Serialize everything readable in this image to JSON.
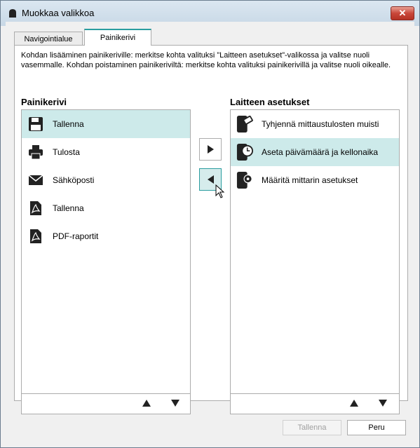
{
  "window": {
    "title": "Muokkaa valikkoa"
  },
  "tabs": [
    {
      "label": "Navigointialue"
    },
    {
      "label": "Painikerivi"
    }
  ],
  "description": "Kohdan lisääminen painikeriville: merkitse kohta valituksi ”Laitteen asetukset”-valikossa ja valitse nuoli vasemmalle. Kohdan poistaminen painikeriviltä: merkitse kohta valituksi painikerivillä ja valitse nuoli oikealle.",
  "left_list": {
    "title": "Painikerivi",
    "items": [
      {
        "label": "Tallenna",
        "icon": "save-icon",
        "selected": true
      },
      {
        "label": "Tulosta",
        "icon": "printer-icon",
        "selected": false
      },
      {
        "label": "Sähköposti",
        "icon": "mail-icon",
        "selected": false
      },
      {
        "label": "Tallenna",
        "icon": "pdf-icon",
        "selected": false
      },
      {
        "label": "PDF-raportit",
        "icon": "pdf-report-icon",
        "selected": false
      }
    ]
  },
  "right_list": {
    "title": "Laitteen asetukset",
    "items": [
      {
        "label": "Tyhjennä mittaustulosten muisti",
        "icon": "device-erase-icon",
        "selected": false
      },
      {
        "label": "Aseta päivämäärä ja kellonaika",
        "icon": "device-clock-icon",
        "selected": true
      },
      {
        "label": "Määritä mittarin asetukset",
        "icon": "device-gear-icon",
        "selected": false
      }
    ]
  },
  "buttons": {
    "ok": "Tallenna",
    "cancel": "Peru"
  },
  "colors": {
    "accent": "#2a9d9f",
    "selection": "#cdeaea"
  }
}
